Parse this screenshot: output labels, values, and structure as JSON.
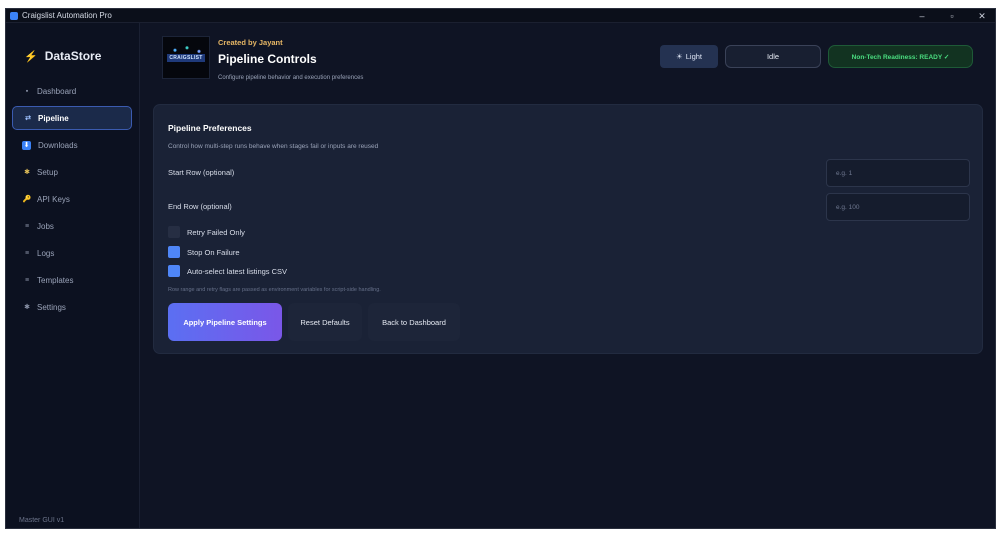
{
  "window": {
    "title": "Craigslist Automation Pro",
    "controls": [
      "–",
      "▫",
      "✕"
    ]
  },
  "sidebar": {
    "brand": "DataStore",
    "brand_icon": "⚡",
    "items": [
      {
        "label": "Dashboard",
        "icon": "▪"
      },
      {
        "label": "Pipeline",
        "icon": "⇄"
      },
      {
        "label": "Downloads",
        "icon": "⬇"
      },
      {
        "label": "Setup",
        "icon": "✱"
      },
      {
        "label": "API Keys",
        "icon": "🔑"
      },
      {
        "label": "Jobs",
        "icon": "≡"
      },
      {
        "label": "Logs",
        "icon": "≡"
      },
      {
        "label": "Templates",
        "icon": "≡"
      },
      {
        "label": "Settings",
        "icon": "✱"
      }
    ],
    "footer": "Master GUI v1"
  },
  "header": {
    "logo_text": "CRAIGSLIST",
    "created_by": "Created by Jayant",
    "title": "Pipeline Controls",
    "subtitle": "Configure pipeline behavior and execution preferences",
    "theme_button": "Light",
    "theme_icon": "☀",
    "status": "Idle",
    "readiness": "Non-Tech Readiness: READY ✓"
  },
  "card": {
    "title": "Pipeline Preferences",
    "subtitle": "Control how multi-step runs behave when stages fail or inputs are reused",
    "start_row": {
      "label": "Start Row (optional)",
      "placeholder": "e.g. 1",
      "value": ""
    },
    "end_row": {
      "label": "End Row (optional)",
      "placeholder": "e.g. 100",
      "value": ""
    },
    "checkboxes": [
      {
        "label": "Retry Failed Only",
        "checked": false
      },
      {
        "label": "Stop On Failure",
        "checked": true
      },
      {
        "label": "Auto-select latest listings CSV",
        "checked": true
      }
    ],
    "hint": "Row range and retry flags are passed as environment variables for script-side handling.",
    "apply_button": "Apply Pipeline Settings",
    "reset_button": "Reset Defaults",
    "back_button": "Back to Dashboard"
  },
  "colors": {
    "accent": "#4f86f7",
    "ready": "#4ade80",
    "brand_bolt": "#f59e0b",
    "bg": "#0f1424"
  }
}
